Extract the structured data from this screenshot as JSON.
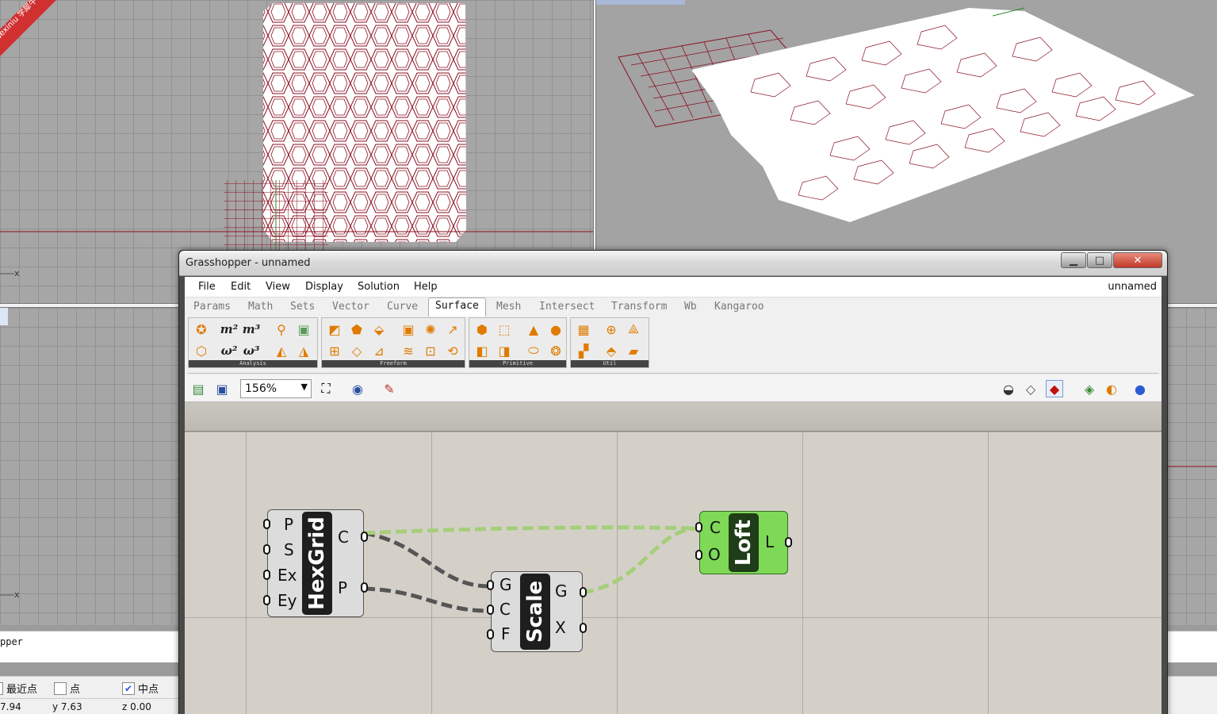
{
  "watermark": "xuexiniu 学犀牛中文网",
  "viewports": {
    "top_axis_x": "x",
    "front_axis_x": "x"
  },
  "command_line": {
    "history_text": "pper"
  },
  "osnap": {
    "items": [
      {
        "label": "最近点",
        "checked": false
      },
      {
        "label": "点",
        "checked": false
      },
      {
        "label": "中点",
        "checked": true
      }
    ]
  },
  "coords": {
    "x": "7.94",
    "y": "y 7.63",
    "z": "z 0.00"
  },
  "gh": {
    "title": "Grasshopper - unnamed",
    "doc_name": "unnamed",
    "menu": [
      "File",
      "Edit",
      "View",
      "Display",
      "Solution",
      "Help"
    ],
    "tabs": [
      "Params",
      "Math",
      "Sets",
      "Vector",
      "Curve",
      "Surface",
      "Mesh",
      "Intersect",
      "Transform",
      "Wb",
      "Kangaroo"
    ],
    "active_tab": "Surface",
    "ribbon_panels": [
      "Analysis",
      "Freeform",
      "Primitive",
      "Util"
    ],
    "zoom": "156%",
    "window_buttons": {
      "min": "▁",
      "max": "□",
      "close": "✕"
    },
    "components": {
      "hexgrid": {
        "name": "HexGrid",
        "inputs": [
          "P",
          "S",
          "Ex",
          "Ey"
        ],
        "outputs": [
          "C",
          "P"
        ]
      },
      "scale": {
        "name": "Scale",
        "inputs": [
          "G",
          "C",
          "F"
        ],
        "outputs": [
          "G",
          "X"
        ]
      },
      "loft": {
        "name": "Loft",
        "inputs": [
          "C",
          "O"
        ],
        "outputs": [
          "L"
        ]
      }
    },
    "colors": {
      "wire_dark": "#555555",
      "wire_green": "#a5cf7a",
      "loft_fill": "#7ed957"
    }
  }
}
